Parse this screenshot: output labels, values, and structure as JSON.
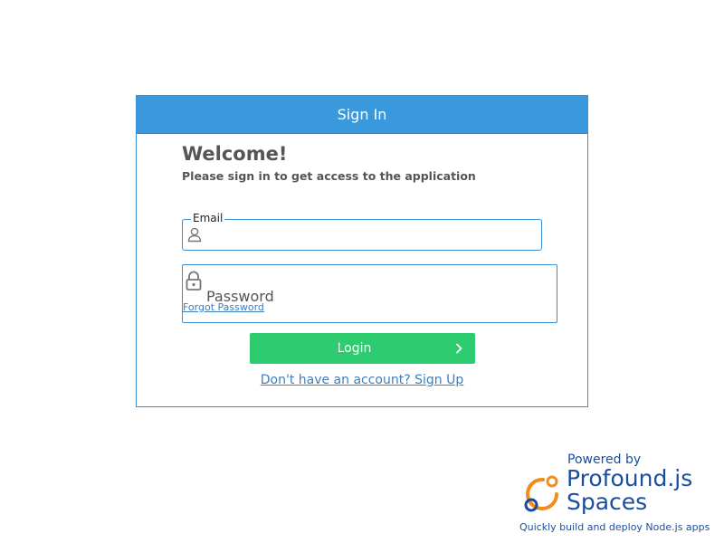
{
  "panel": {
    "header_title": "Sign In",
    "welcome": "Welcome!",
    "subtitle": "Please sign in to get access to the application"
  },
  "email": {
    "legend": "Email",
    "value": "",
    "icon": "user-icon"
  },
  "password": {
    "placeholder": "Password",
    "value": "",
    "forgot_label": "Forgot Password",
    "icon": "lock-icon"
  },
  "login": {
    "label": "Login",
    "icon": "chevron-right-icon"
  },
  "signup_link": "Don't have an account? Sign Up",
  "brand": {
    "powered_by": "Powered by",
    "name_line1": "Profound.js",
    "name_line2": "Spaces",
    "tagline": "Quickly build and deploy Node.js apps"
  },
  "colors": {
    "header_blue": "#3a98dd",
    "border_blue": "#3a8fd6",
    "login_green": "#2ecc71",
    "link_blue": "#3a7fc0",
    "brand_navy": "#1a4d9e",
    "brand_orange": "#f28c1e"
  }
}
